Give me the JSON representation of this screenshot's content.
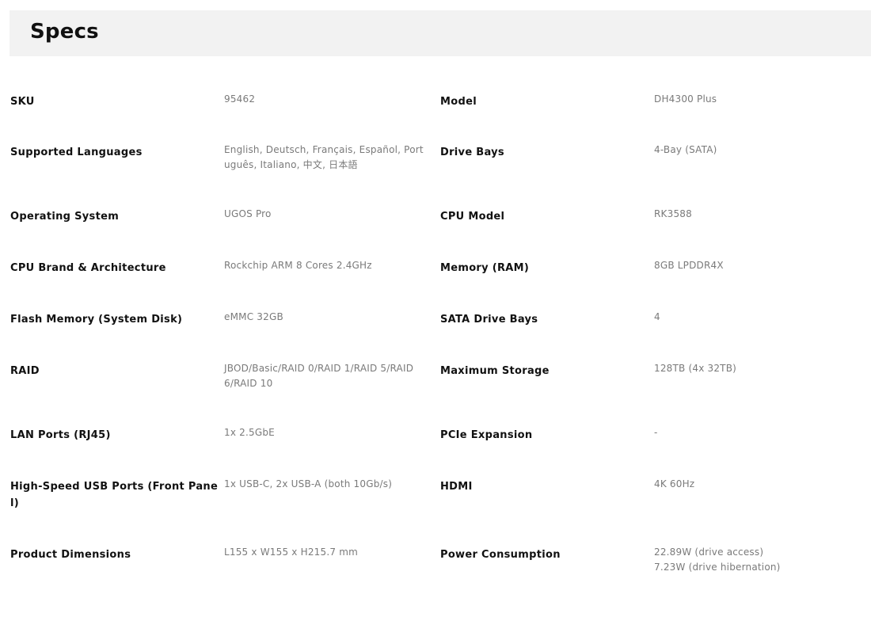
{
  "header": {
    "title": "Specs"
  },
  "specs": {
    "rows": [
      {
        "left_label": "SKU",
        "left_value": "95462",
        "right_label": "Model",
        "right_value": "DH4300 Plus"
      },
      {
        "left_label": "Supported Languages",
        "left_value": "English, Deutsch, Français, Español, Português, Italiano, 中文, 日本語",
        "right_label": "Drive Bays",
        "right_value": "4-Bay (SATA)"
      },
      {
        "left_label": "Operating System",
        "left_value": "UGOS Pro",
        "right_label": "CPU Model",
        "right_value": "RK3588"
      },
      {
        "left_label": "CPU Brand & Architecture",
        "left_value": "Rockchip ARM 8 Cores 2.4GHz",
        "right_label": "Memory (RAM)",
        "right_value": "8GB LPDDR4X"
      },
      {
        "left_label": "Flash Memory (System Disk)",
        "left_value": "eMMC 32GB",
        "right_label": "SATA Drive Bays",
        "right_value": "4"
      },
      {
        "left_label": "RAID",
        "left_value": "JBOD/Basic/RAID 0/RAID 1/RAID 5/RAID 6/RAID 10",
        "right_label": "Maximum Storage",
        "right_value": "128TB (4x 32TB)"
      },
      {
        "left_label": "LAN Ports (RJ45)",
        "left_value": "1x 2.5GbE",
        "right_label": "PCIe Expansion",
        "right_value": "-"
      },
      {
        "left_label": "High-Speed USB Ports (Front Panel)",
        "left_value": "1x USB-C, 2x USB-A (both 10Gb/s)",
        "right_label": "HDMI",
        "right_value": "4K 60Hz"
      },
      {
        "left_label": "Product Dimensions",
        "left_value": "L155 x W155 x H215.7 mm",
        "right_label": "Power Consumption",
        "right_value": "22.89W (drive access)\n7.23W (drive hibernation)"
      }
    ]
  }
}
